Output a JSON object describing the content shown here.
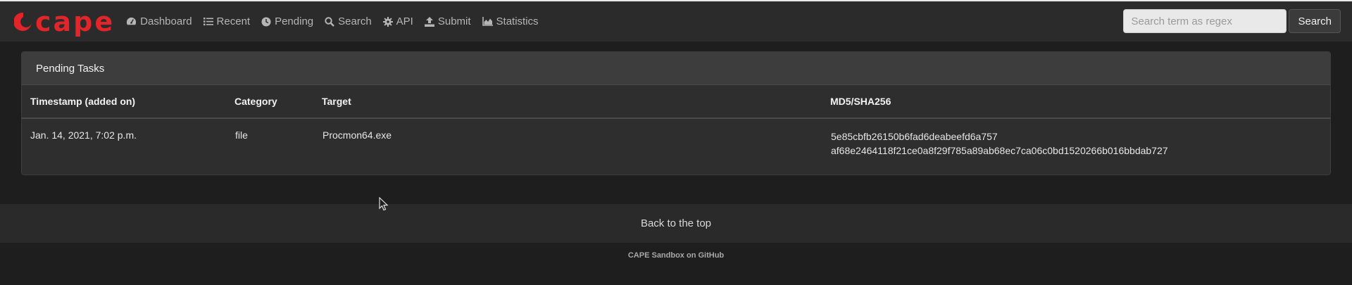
{
  "brand": {
    "name": "cape",
    "color": "#e2242b"
  },
  "nav": {
    "items": [
      {
        "label": "Dashboard",
        "icon": "dashboard-icon"
      },
      {
        "label": "Recent",
        "icon": "list-icon"
      },
      {
        "label": "Pending",
        "icon": "clock-icon"
      },
      {
        "label": "Search",
        "icon": "search-icon"
      },
      {
        "label": "API",
        "icon": "gear-icon"
      },
      {
        "label": "Submit",
        "icon": "upload-icon"
      },
      {
        "label": "Statistics",
        "icon": "area-chart-icon"
      }
    ],
    "search": {
      "placeholder": "Search term as regex",
      "value": "",
      "button_label": "Search"
    }
  },
  "panel": {
    "title": "Pending Tasks",
    "columns": [
      "Timestamp (added on)",
      "Category",
      "Target",
      "MD5/SHA256"
    ],
    "rows": [
      {
        "timestamp": "Jan. 14, 2021, 7:02 p.m.",
        "category": "file",
        "target": "Procmon64.exe",
        "md5": "5e85cbfb26150b6fad6deabeefd6a757",
        "sha256": "af68e2464118f21ce0a8f29f785a89ab68ec7ca06c0bd1520266b016bbdab727"
      }
    ]
  },
  "footer": {
    "back_to_top": "Back to the top",
    "github_link": "CAPE Sandbox on GitHub"
  }
}
